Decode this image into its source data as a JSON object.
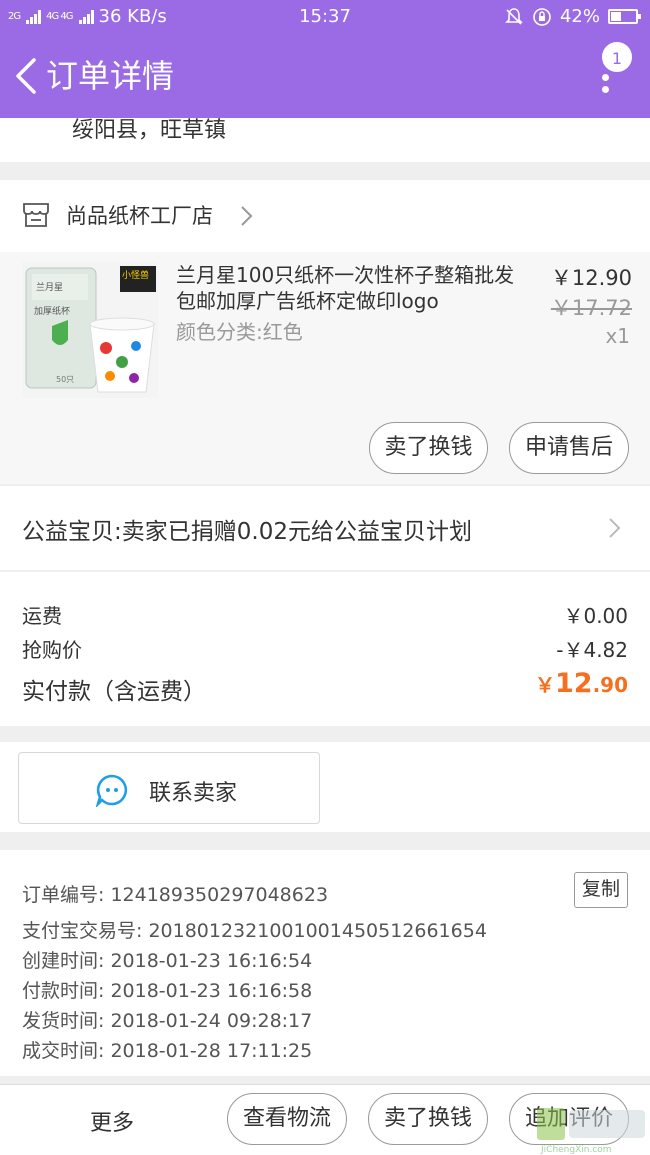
{
  "status_bar": {
    "network_left": "2G",
    "network_right": "4G 4G",
    "speed": "36 KB/s",
    "time": "15:37",
    "battery": "42%",
    "battery_level": 0.42
  },
  "header": {
    "title": "订单详情",
    "badge_count": "1"
  },
  "address": {
    "tail": "绥阳县，旺草镇"
  },
  "shop": {
    "name": "尚品纸杯工厂店"
  },
  "product": {
    "title": "兰月星100只纸杯一次性杯子整箱批发包邮加厚广告纸杯定做印logo",
    "sku": "颜色分类:红色",
    "price": "￥12.90",
    "original_price": "￥17.72",
    "quantity": "x1",
    "sell_button": "卖了换钱",
    "after_sale_button": "申请售后",
    "thumb_tag": "小怪兽",
    "thumb_brand": "兰月星",
    "thumb_sub": "加厚纸杯",
    "thumb_count": "50只"
  },
  "charity": {
    "text": "公益宝贝:卖家已捐赠0.02元给公益宝贝计划"
  },
  "fees": {
    "shipping_label": "运费",
    "shipping_value": "￥0.00",
    "flash_label": "抢购价",
    "flash_value": "-￥4.82",
    "total_label": "实付款（含运费）",
    "total_symbol": "￥",
    "total_int": "12",
    "total_dec": ".90"
  },
  "contact": {
    "label": "联系卖家"
  },
  "order_info": {
    "order_no": "订单编号: 124189350297048623",
    "alipay_no": "支付宝交易号: 2018012321001001450512661654",
    "created": "创建时间: 2018-01-23 16:16:54",
    "paid": "付款时间: 2018-01-23 16:16:58",
    "shipped": "发货时间: 2018-01-24 09:28:17",
    "completed": "成交时间: 2018-01-28 17:11:25",
    "copy_button": "复制"
  },
  "bottom_bar": {
    "more": "更多",
    "logistics": "查看物流",
    "sell": "卖了换钱",
    "review": "追加评价"
  },
  "watermark": {
    "text": "JiChengXin.com"
  },
  "colors": {
    "header": "#9b6be6",
    "accent_orange": "#f56f1e",
    "contact_icon": "#1e9ee8"
  }
}
